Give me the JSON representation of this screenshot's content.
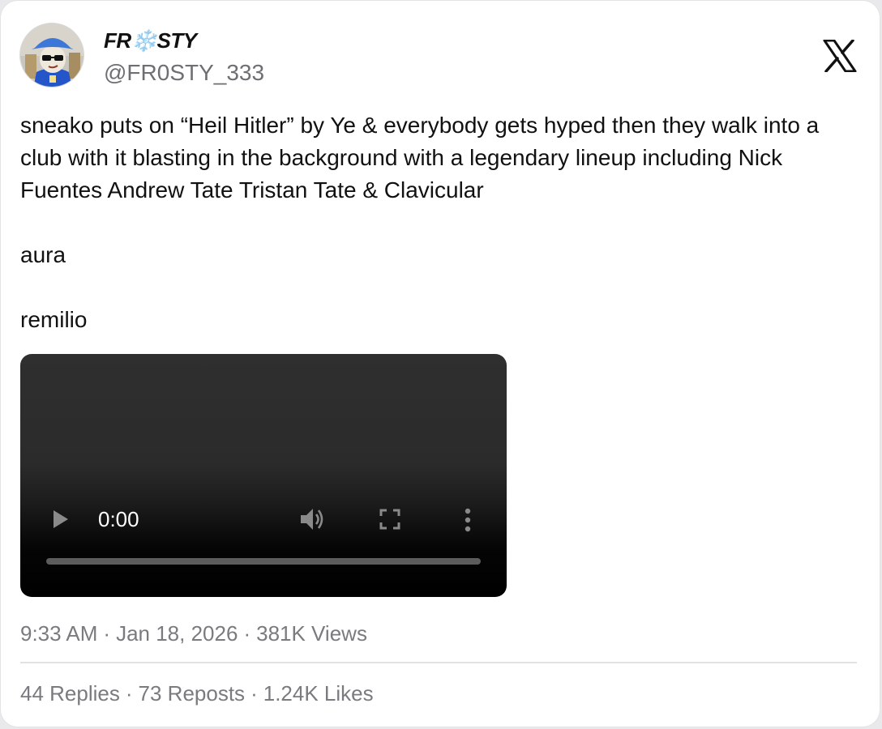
{
  "author": {
    "display_name": "FR❄️STY",
    "handle": "@FR0STY_333",
    "avatar_icon": "avatar-cartoon-bucket-hat"
  },
  "brand": {
    "logo_icon": "x-logo-icon"
  },
  "tweet": {
    "lines": [
      "sneako puts on “Heil Hitler” by Ye & everybody gets hyped then they walk into a club with it blasting in the background with a legendary lineup including Nick Fuentes Andrew Tate Tristan Tate & Clavicular",
      "aura",
      "remilio"
    ]
  },
  "video": {
    "time": "0:00",
    "progress": 0,
    "controls": [
      "play-icon",
      "volume-icon",
      "fullscreen-icon",
      "more-vertical-icon"
    ]
  },
  "meta": {
    "time": "9:33 AM",
    "date": "Jan 18, 2026",
    "views": "381K Views",
    "separator": "·"
  },
  "stats": {
    "replies": "44 Replies",
    "reposts": "73 Reposts",
    "likes": "1.24K Likes",
    "separator": "·"
  },
  "colors": {
    "text": "#111111",
    "muted": "#6e6e73",
    "divider": "#e2e2e5",
    "avatar_blue": "#2456c9"
  }
}
